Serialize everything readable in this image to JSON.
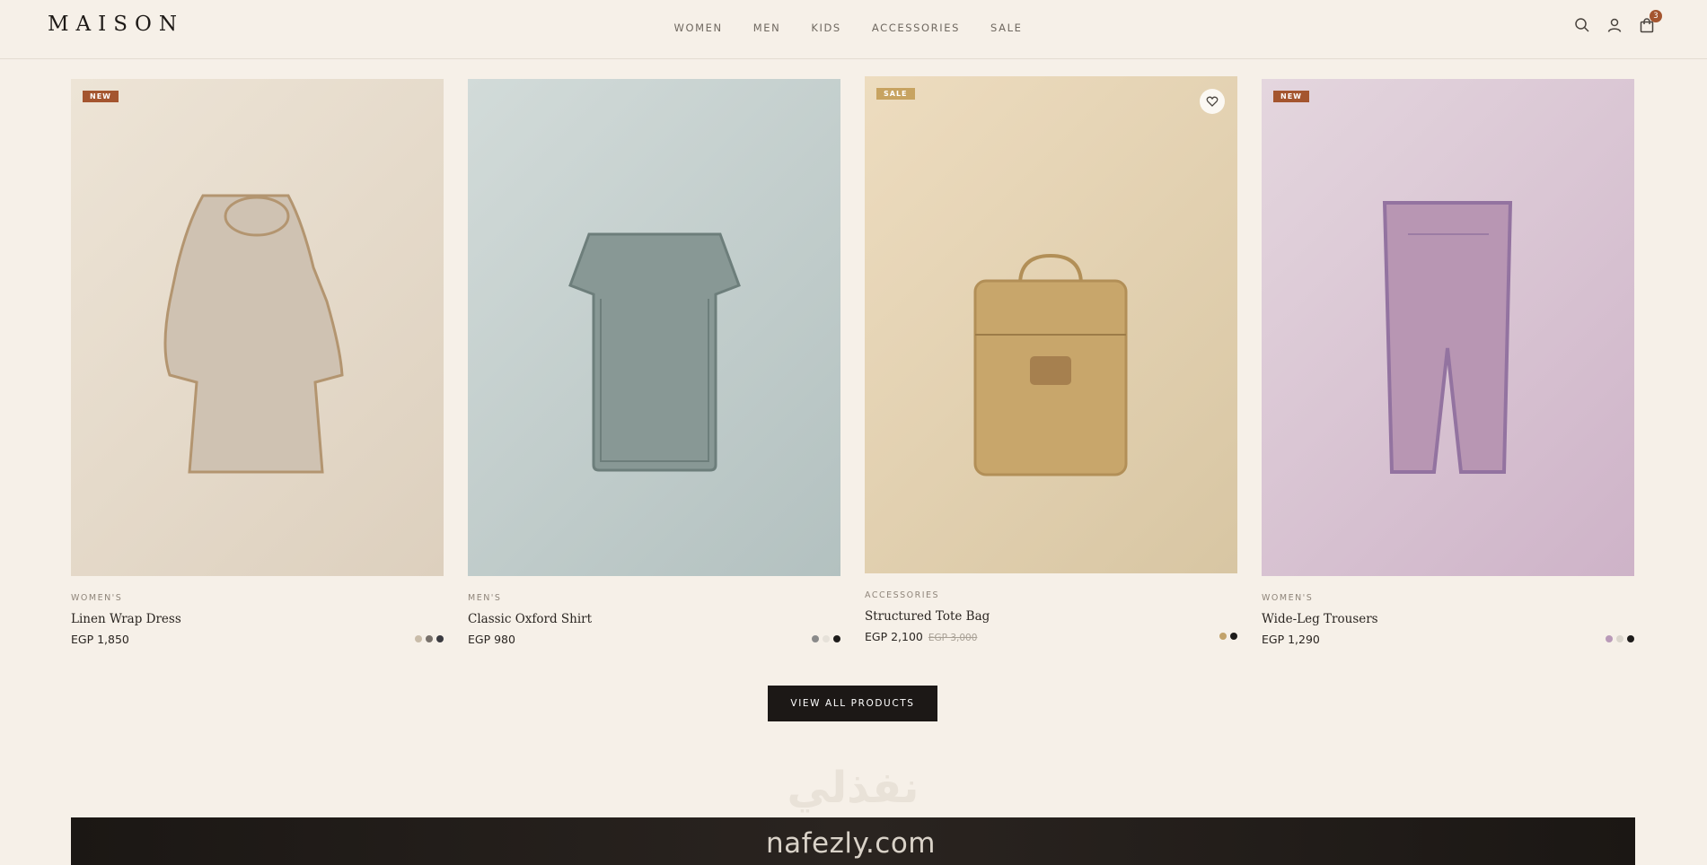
{
  "header": {
    "logo": "MAISON",
    "nav": [
      "WOMEN",
      "MEN",
      "KIDS",
      "ACCESSORIES",
      "SALE"
    ],
    "icons": [
      "search-icon",
      "account-icon",
      "cart-icon"
    ],
    "cart_count": "3"
  },
  "products": [
    {
      "badge": "NEW",
      "category": "WOMEN'S",
      "name": "Linen Wrap Dress",
      "price": "EGP 1,850",
      "old_price": "",
      "swatches": [
        "#c9bca9",
        "#77706a",
        "#3a3a40"
      ],
      "image_colors": [
        "#ece3d5",
        "#dccfbd"
      ]
    },
    {
      "badge": "",
      "category": "MEN'S",
      "name": "Classic Oxford Shirt",
      "price": "EGP 980",
      "old_price": "",
      "swatches": [
        "#8a8a8a",
        "#e6e1d9",
        "#1e1c1b"
      ],
      "image_colors": [
        "#cfd8d6",
        "#b5c3c2"
      ]
    },
    {
      "badge": "SALE",
      "category": "ACCESSORIES",
      "name": "Structured Tote Bag",
      "price": "EGP 2,100",
      "old_price": "EGP 3,000",
      "swatches": [
        "#c2a26a",
        "#1e1c1b"
      ],
      "image_colors": [
        "#ecdcc0",
        "#d9c7a5"
      ],
      "wishlist": "heart-icon"
    },
    {
      "badge": "NEW",
      "category": "WOMEN'S",
      "name": "Wide-Leg Trousers",
      "price": "EGP 1,290",
      "old_price": "",
      "swatches": [
        "#b99ab8",
        "#dbd6cd",
        "#1e1c1b"
      ],
      "image_colors": [
        "#e2d3dc",
        "#cfb4c9"
      ]
    }
  ],
  "cta": {
    "label": "VIEW ALL PRODUCTS"
  },
  "watermark": {
    "arabic": "نفذلي",
    "latin": "nafezly.com"
  },
  "colors": {
    "background": "#f6f0e8",
    "accent": "#a4552f",
    "sale": "#c7a361",
    "dark": "#1c1816"
  }
}
